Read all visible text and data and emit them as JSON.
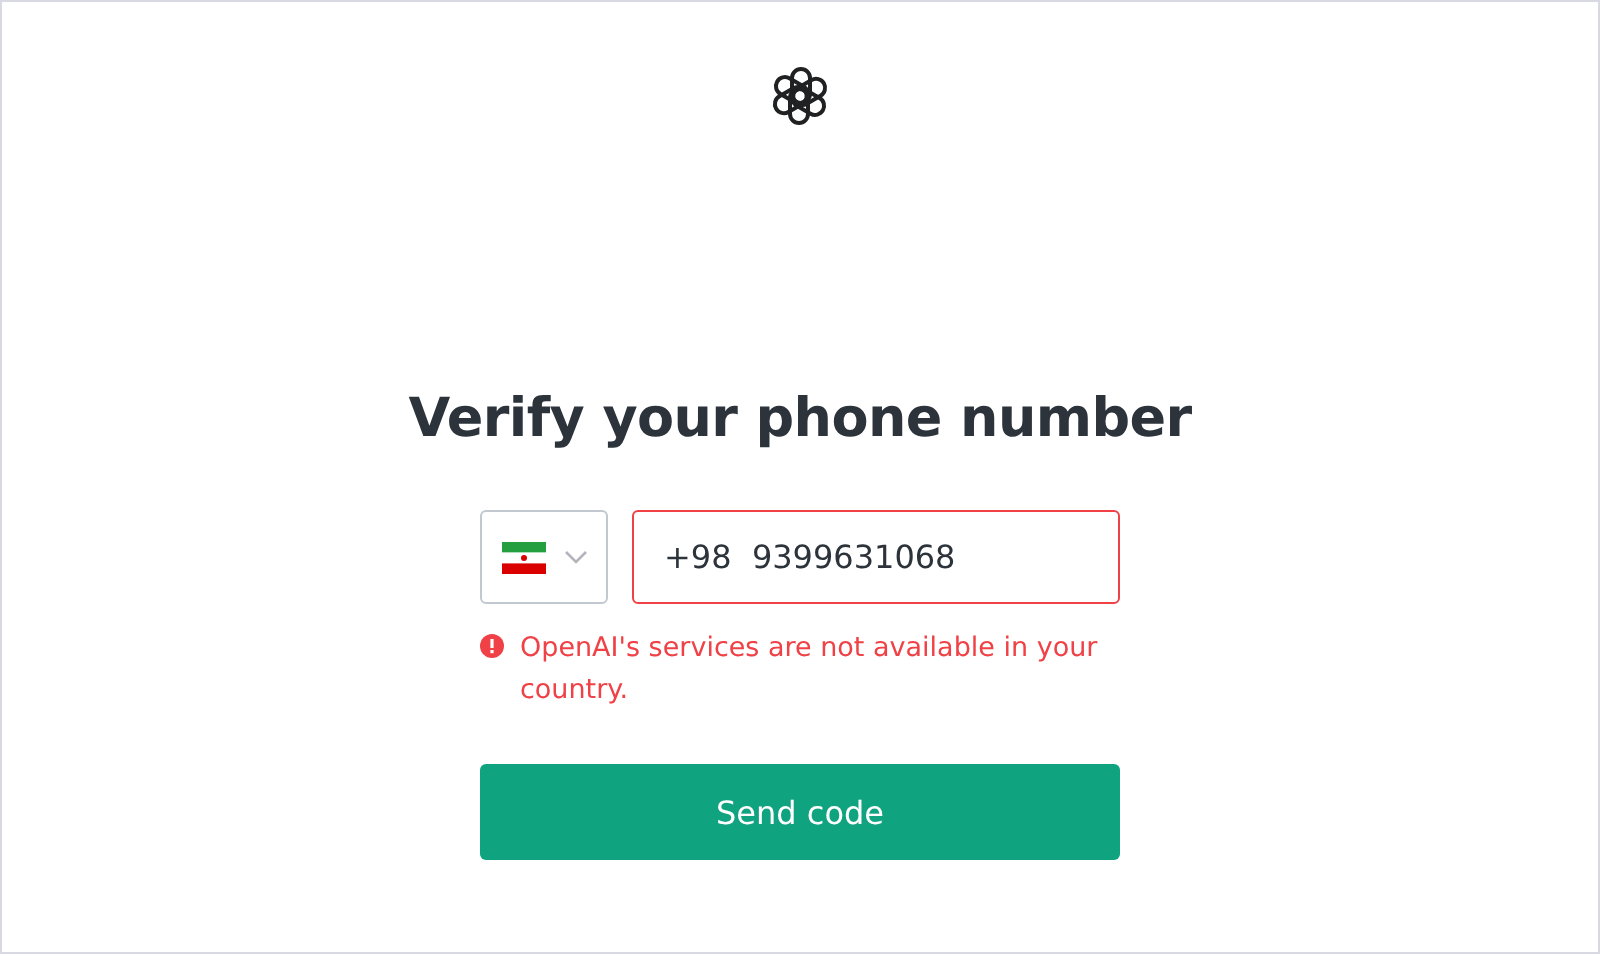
{
  "heading": "Verify your phone number",
  "phone": {
    "country_picker": {
      "expanded": false
    },
    "value": "+98  9399631068",
    "invalid": true
  },
  "error": "OpenAI's services are not available in your country.",
  "button": "Send code"
}
